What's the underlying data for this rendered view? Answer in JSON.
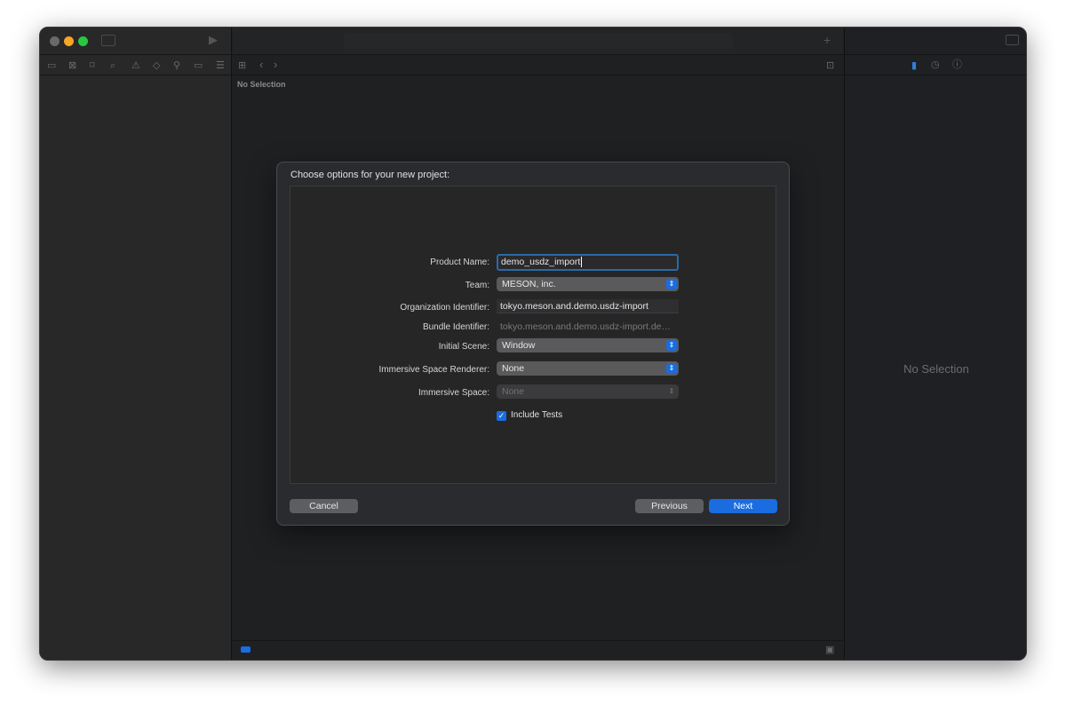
{
  "navigator": {
    "no_selection": "No Selection"
  },
  "editor": {
    "no_selection": "No Selection"
  },
  "inspector": {
    "no_selection": "No Selection"
  },
  "dialog": {
    "title": "Choose options for your new project:",
    "fields": {
      "product_name": {
        "label": "Product Name:",
        "value": "demo_usdz_import"
      },
      "team": {
        "label": "Team:",
        "value": "MESON, inc."
      },
      "org_id": {
        "label": "Organization Identifier:",
        "value": "tokyo.meson.and.demo.usdz-import"
      },
      "bundle_id": {
        "label": "Bundle Identifier:",
        "value": "tokyo.meson.and.demo.usdz-import.demo-..."
      },
      "initial_scene": {
        "label": "Initial Scene:",
        "value": "Window"
      },
      "renderer": {
        "label": "Immersive Space Renderer:",
        "value": "None"
      },
      "immersive_space": {
        "label": "Immersive Space:",
        "value": "None"
      }
    },
    "include_tests": {
      "label": "Include Tests",
      "checked": true
    },
    "buttons": {
      "cancel": "Cancel",
      "previous": "Previous",
      "next": "Next"
    }
  },
  "colors": {
    "accent": "#1a6ce0",
    "focus_ring": "#2a6aa8"
  }
}
